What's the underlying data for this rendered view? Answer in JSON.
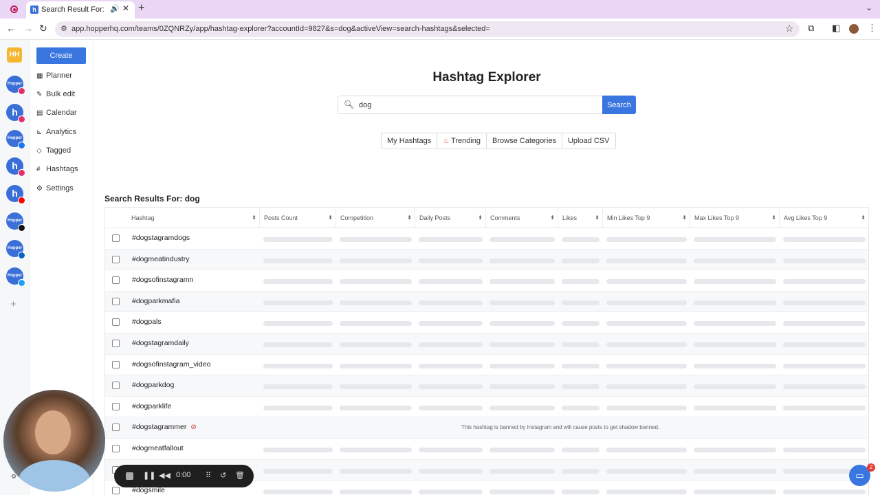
{
  "browser": {
    "tab_title": "Search Result For: dog - h",
    "url": "app.hopperhq.com/teams/0ZQNRZy/app/hashtag-explorer?accountId=9827&s=dog&activeView=search-hashtags&selected="
  },
  "app": {
    "logo": "HH",
    "accounts": [
      {
        "label": "Hopper",
        "network": "instagram",
        "color": "#e1306c"
      },
      {
        "label": "h",
        "network": "instagram",
        "color": "#e1306c"
      },
      {
        "label": "Hopper",
        "network": "facebook",
        "color": "#1877f2"
      },
      {
        "label": "h",
        "network": "instagram",
        "color": "#e1306c"
      },
      {
        "label": "h",
        "network": "youtube",
        "color": "#ff0000"
      },
      {
        "label": "Hopper",
        "network": "tiktok",
        "color": "#111111"
      },
      {
        "label": "Hopper",
        "network": "linkedin",
        "color": "#0a66c2"
      },
      {
        "label": "Hopper",
        "network": "twitter",
        "color": "#1da1f2"
      }
    ]
  },
  "sidebar": {
    "create_label": "Create",
    "items": [
      {
        "label": "Planner",
        "icon": "grid-icon"
      },
      {
        "label": "Bulk edit",
        "icon": "edit-icon"
      },
      {
        "label": "Calendar",
        "icon": "calendar-icon"
      },
      {
        "label": "Analytics",
        "icon": "chart-icon"
      },
      {
        "label": "Tagged",
        "icon": "tag-icon"
      },
      {
        "label": "Hashtags",
        "icon": "hash-icon"
      },
      {
        "label": "Settings",
        "icon": "gear-icon"
      }
    ]
  },
  "main": {
    "title": "Hashtag Explorer",
    "search_value": "dog",
    "search_button": "Search",
    "tabs": [
      "My Hashtags",
      "Trending",
      "Browse Categories",
      "Upload CSV"
    ],
    "results_title": "Search Results For: dog",
    "columns": [
      "Hashtag",
      "Posts Count",
      "Competition",
      "Daily Posts",
      "Comments",
      "Likes",
      "Min Likes Top 9",
      "Max Likes Top 9",
      "Avg Likes Top 9"
    ],
    "rows": [
      {
        "tag": "#dogstagramdogs",
        "banned": false
      },
      {
        "tag": "#dogmeatindustry",
        "banned": false
      },
      {
        "tag": "#dogsofinstagramn",
        "banned": false
      },
      {
        "tag": "#dogparkmafia",
        "banned": false
      },
      {
        "tag": "#dogpals",
        "banned": false
      },
      {
        "tag": "#dogstagramdaily",
        "banned": false
      },
      {
        "tag": "#dogsofinstagram_video",
        "banned": false
      },
      {
        "tag": "#dogparkdog",
        "banned": false
      },
      {
        "tag": "#dogparklife",
        "banned": false
      },
      {
        "tag": "#dogstagrammer",
        "banned": true
      },
      {
        "tag": "#dogmeatfallout",
        "banned": false
      },
      {
        "tag": "",
        "banned": false
      },
      {
        "tag": "#dogsmile",
        "banned": false
      }
    ],
    "banned_message": "This hashtag is banned by Instagram and will cause posts to get shadow banned."
  },
  "recorder": {
    "time": "0:00"
  },
  "chat": {
    "badge": "2"
  }
}
